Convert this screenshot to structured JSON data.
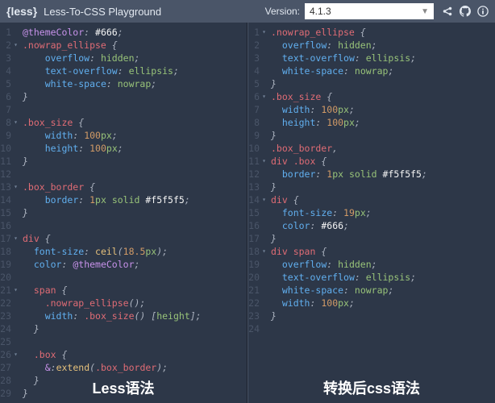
{
  "header": {
    "logo": "{less}",
    "title": "Less-To-CSS Playground",
    "version_label": "Version:",
    "version_value": "4.1.3"
  },
  "left": {
    "caption": "Less语法",
    "lines": [
      {
        "n": 1,
        "fold": "",
        "tokens": [
          [
            "at",
            "@themeColor"
          ],
          [
            "punc",
            ": "
          ],
          [
            "str",
            "#666"
          ],
          [
            "punc",
            ";"
          ]
        ]
      },
      {
        "n": 2,
        "fold": "▾",
        "tokens": [
          [
            "sel",
            ".nowrap_ellipse "
          ],
          [
            "punc",
            "{"
          ]
        ]
      },
      {
        "n": 3,
        "fold": "",
        "tokens": [
          [
            "plain",
            "    "
          ],
          [
            "prop",
            "overflow"
          ],
          [
            "punc",
            ": "
          ],
          [
            "val",
            "hidden"
          ],
          [
            "punc",
            ";"
          ]
        ]
      },
      {
        "n": 4,
        "fold": "",
        "tokens": [
          [
            "plain",
            "    "
          ],
          [
            "prop",
            "text-overflow"
          ],
          [
            "punc",
            ": "
          ],
          [
            "val",
            "ellipsis"
          ],
          [
            "punc",
            ";"
          ]
        ]
      },
      {
        "n": 5,
        "fold": "",
        "tokens": [
          [
            "plain",
            "    "
          ],
          [
            "prop",
            "white-space"
          ],
          [
            "punc",
            ": "
          ],
          [
            "val",
            "nowrap"
          ],
          [
            "punc",
            ";"
          ]
        ]
      },
      {
        "n": 6,
        "fold": "",
        "tokens": [
          [
            "punc",
            "}"
          ]
        ]
      },
      {
        "n": 7,
        "fold": "",
        "tokens": []
      },
      {
        "n": 8,
        "fold": "▾",
        "tokens": [
          [
            "sel",
            ".box_size "
          ],
          [
            "punc",
            "{"
          ]
        ]
      },
      {
        "n": 9,
        "fold": "",
        "tokens": [
          [
            "plain",
            "    "
          ],
          [
            "prop",
            "width"
          ],
          [
            "punc",
            ": "
          ],
          [
            "num",
            "100"
          ],
          [
            "val",
            "px"
          ],
          [
            "punc",
            ";"
          ]
        ]
      },
      {
        "n": 10,
        "fold": "",
        "tokens": [
          [
            "plain",
            "    "
          ],
          [
            "prop",
            "height"
          ],
          [
            "punc",
            ": "
          ],
          [
            "num",
            "100"
          ],
          [
            "val",
            "px"
          ],
          [
            "punc",
            ";"
          ]
        ]
      },
      {
        "n": 11,
        "fold": "",
        "tokens": [
          [
            "punc",
            "}"
          ]
        ]
      },
      {
        "n": 12,
        "fold": "",
        "tokens": []
      },
      {
        "n": 13,
        "fold": "▾",
        "tokens": [
          [
            "sel",
            ".box_border "
          ],
          [
            "punc",
            "{"
          ]
        ]
      },
      {
        "n": 14,
        "fold": "",
        "tokens": [
          [
            "plain",
            "    "
          ],
          [
            "prop",
            "border"
          ],
          [
            "punc",
            ": "
          ],
          [
            "num",
            "1"
          ],
          [
            "val",
            "px solid "
          ],
          [
            "str",
            "#f5f5f5"
          ],
          [
            "punc",
            ";"
          ]
        ]
      },
      {
        "n": 15,
        "fold": "",
        "tokens": [
          [
            "punc",
            "}"
          ]
        ]
      },
      {
        "n": 16,
        "fold": "",
        "tokens": []
      },
      {
        "n": 17,
        "fold": "▾",
        "tokens": [
          [
            "sel",
            "div "
          ],
          [
            "punc",
            "{"
          ]
        ]
      },
      {
        "n": 18,
        "fold": "",
        "tokens": [
          [
            "plain",
            "  "
          ],
          [
            "prop",
            "font-size"
          ],
          [
            "punc",
            ": "
          ],
          [
            "fn",
            "ceil"
          ],
          [
            "punc",
            "("
          ],
          [
            "num",
            "18.5"
          ],
          [
            "val",
            "px"
          ],
          [
            "punc",
            ");"
          ]
        ]
      },
      {
        "n": 19,
        "fold": "",
        "tokens": [
          [
            "plain",
            "  "
          ],
          [
            "prop",
            "color"
          ],
          [
            "punc",
            ": "
          ],
          [
            "at",
            "@themeColor"
          ],
          [
            "punc",
            ";"
          ]
        ]
      },
      {
        "n": 20,
        "fold": "",
        "tokens": []
      },
      {
        "n": 21,
        "fold": "▾",
        "tokens": [
          [
            "plain",
            "  "
          ],
          [
            "sel",
            "span "
          ],
          [
            "punc",
            "{"
          ]
        ]
      },
      {
        "n": 22,
        "fold": "",
        "tokens": [
          [
            "plain",
            "    "
          ],
          [
            "sel",
            ".nowrap_ellipse"
          ],
          [
            "punc",
            "();"
          ]
        ]
      },
      {
        "n": 23,
        "fold": "",
        "tokens": [
          [
            "plain",
            "    "
          ],
          [
            "prop",
            "width"
          ],
          [
            "punc",
            ": "
          ],
          [
            "sel",
            ".box_size"
          ],
          [
            "punc",
            "() ["
          ],
          [
            "val",
            "height"
          ],
          [
            "punc",
            "];"
          ]
        ]
      },
      {
        "n": 24,
        "fold": "",
        "tokens": [
          [
            "plain",
            "  "
          ],
          [
            "punc",
            "}"
          ]
        ]
      },
      {
        "n": 25,
        "fold": "",
        "tokens": []
      },
      {
        "n": 26,
        "fold": "▾",
        "tokens": [
          [
            "plain",
            "  "
          ],
          [
            "sel",
            ".box "
          ],
          [
            "punc",
            "{"
          ]
        ]
      },
      {
        "n": 27,
        "fold": "",
        "tokens": [
          [
            "plain",
            "    "
          ],
          [
            "at",
            "&"
          ],
          [
            "punc",
            ":"
          ],
          [
            "fn",
            "extend"
          ],
          [
            "punc",
            "("
          ],
          [
            "sel",
            ".box_border"
          ],
          [
            "punc",
            ");"
          ]
        ]
      },
      {
        "n": 28,
        "fold": "",
        "tokens": [
          [
            "plain",
            "  "
          ],
          [
            "punc",
            "}"
          ]
        ]
      },
      {
        "n": 29,
        "fold": "",
        "tokens": [
          [
            "punc",
            "}"
          ]
        ]
      }
    ]
  },
  "right": {
    "caption": "转换后css语法",
    "lines": [
      {
        "n": 1,
        "fold": "▾",
        "tokens": [
          [
            "sel",
            ".nowrap_ellipse "
          ],
          [
            "punc",
            "{"
          ]
        ]
      },
      {
        "n": 2,
        "fold": "",
        "tokens": [
          [
            "plain",
            "  "
          ],
          [
            "prop",
            "overflow"
          ],
          [
            "punc",
            ": "
          ],
          [
            "val",
            "hidden"
          ],
          [
            "punc",
            ";"
          ]
        ]
      },
      {
        "n": 3,
        "fold": "",
        "tokens": [
          [
            "plain",
            "  "
          ],
          [
            "prop",
            "text-overflow"
          ],
          [
            "punc",
            ": "
          ],
          [
            "val",
            "ellipsis"
          ],
          [
            "punc",
            ";"
          ]
        ]
      },
      {
        "n": 4,
        "fold": "",
        "tokens": [
          [
            "plain",
            "  "
          ],
          [
            "prop",
            "white-space"
          ],
          [
            "punc",
            ": "
          ],
          [
            "val",
            "nowrap"
          ],
          [
            "punc",
            ";"
          ]
        ]
      },
      {
        "n": 5,
        "fold": "",
        "tokens": [
          [
            "punc",
            "}"
          ]
        ]
      },
      {
        "n": 6,
        "fold": "▾",
        "tokens": [
          [
            "sel",
            ".box_size "
          ],
          [
            "punc",
            "{"
          ]
        ]
      },
      {
        "n": 7,
        "fold": "",
        "tokens": [
          [
            "plain",
            "  "
          ],
          [
            "prop",
            "width"
          ],
          [
            "punc",
            ": "
          ],
          [
            "num",
            "100"
          ],
          [
            "val",
            "px"
          ],
          [
            "punc",
            ";"
          ]
        ]
      },
      {
        "n": 8,
        "fold": "",
        "tokens": [
          [
            "plain",
            "  "
          ],
          [
            "prop",
            "height"
          ],
          [
            "punc",
            ": "
          ],
          [
            "num",
            "100"
          ],
          [
            "val",
            "px"
          ],
          [
            "punc",
            ";"
          ]
        ]
      },
      {
        "n": 9,
        "fold": "",
        "tokens": [
          [
            "punc",
            "}"
          ]
        ]
      },
      {
        "n": 10,
        "fold": "",
        "tokens": [
          [
            "sel",
            ".box_border"
          ],
          [
            "punc",
            ","
          ]
        ]
      },
      {
        "n": 11,
        "fold": "▾",
        "tokens": [
          [
            "sel",
            "div .box "
          ],
          [
            "punc",
            "{"
          ]
        ]
      },
      {
        "n": 12,
        "fold": "",
        "tokens": [
          [
            "plain",
            "  "
          ],
          [
            "prop",
            "border"
          ],
          [
            "punc",
            ": "
          ],
          [
            "num",
            "1"
          ],
          [
            "val",
            "px solid "
          ],
          [
            "str",
            "#f5f5f5"
          ],
          [
            "punc",
            ";"
          ]
        ]
      },
      {
        "n": 13,
        "fold": "",
        "tokens": [
          [
            "punc",
            "}"
          ]
        ]
      },
      {
        "n": 14,
        "fold": "▾",
        "tokens": [
          [
            "sel",
            "div "
          ],
          [
            "punc",
            "{"
          ]
        ]
      },
      {
        "n": 15,
        "fold": "",
        "tokens": [
          [
            "plain",
            "  "
          ],
          [
            "prop",
            "font-size"
          ],
          [
            "punc",
            ": "
          ],
          [
            "num",
            "19"
          ],
          [
            "val",
            "px"
          ],
          [
            "punc",
            ";"
          ]
        ]
      },
      {
        "n": 16,
        "fold": "",
        "tokens": [
          [
            "plain",
            "  "
          ],
          [
            "prop",
            "color"
          ],
          [
            "punc",
            ": "
          ],
          [
            "str",
            "#666"
          ],
          [
            "punc",
            ";"
          ]
        ]
      },
      {
        "n": 17,
        "fold": "",
        "tokens": [
          [
            "punc",
            "}"
          ]
        ]
      },
      {
        "n": 18,
        "fold": "▾",
        "tokens": [
          [
            "sel",
            "div span "
          ],
          [
            "punc",
            "{"
          ]
        ]
      },
      {
        "n": 19,
        "fold": "",
        "tokens": [
          [
            "plain",
            "  "
          ],
          [
            "prop",
            "overflow"
          ],
          [
            "punc",
            ": "
          ],
          [
            "val",
            "hidden"
          ],
          [
            "punc",
            ";"
          ]
        ]
      },
      {
        "n": 20,
        "fold": "",
        "tokens": [
          [
            "plain",
            "  "
          ],
          [
            "prop",
            "text-overflow"
          ],
          [
            "punc",
            ": "
          ],
          [
            "val",
            "ellipsis"
          ],
          [
            "punc",
            ";"
          ]
        ]
      },
      {
        "n": 21,
        "fold": "",
        "tokens": [
          [
            "plain",
            "  "
          ],
          [
            "prop",
            "white-space"
          ],
          [
            "punc",
            ": "
          ],
          [
            "val",
            "nowrap"
          ],
          [
            "punc",
            ";"
          ]
        ]
      },
      {
        "n": 22,
        "fold": "",
        "tokens": [
          [
            "plain",
            "  "
          ],
          [
            "prop",
            "width"
          ],
          [
            "punc",
            ": "
          ],
          [
            "num",
            "100"
          ],
          [
            "val",
            "px"
          ],
          [
            "punc",
            ";"
          ]
        ]
      },
      {
        "n": 23,
        "fold": "",
        "tokens": [
          [
            "punc",
            "}"
          ]
        ]
      },
      {
        "n": 24,
        "fold": "",
        "tokens": []
      }
    ]
  }
}
